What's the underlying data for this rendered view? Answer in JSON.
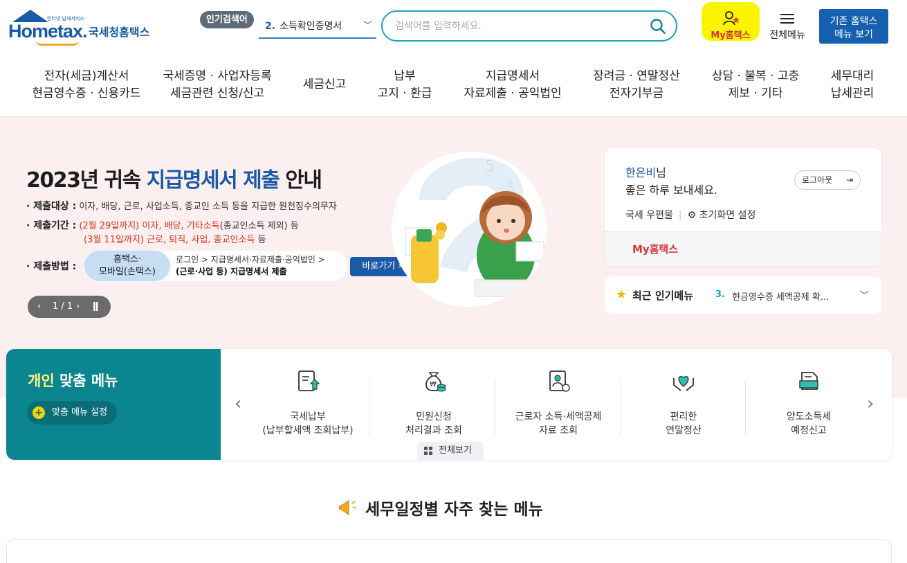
{
  "header": {
    "logo_en": "Hometax.",
    "logo_small": "인터넷 납세서비스",
    "logo_ko": "국세청홈택스",
    "popular_badge": "인기검색어",
    "popular_rank_num": "2.",
    "popular_rank_text": "소득확인증명서",
    "search_placeholder": "검색어를 입력하세요.",
    "my_hometax": "My홈택스",
    "all_menu": "전체메뉴",
    "old_hometax_line1": "기존 홈택스",
    "old_hometax_line2": "메뉴 보기"
  },
  "gnb": [
    {
      "line1": "전자(세금)계산서",
      "line2": "현금영수증 · 신용카드"
    },
    {
      "line1": "국세증명 · 사업자등록",
      "line2": "세금관련 신청/신고"
    },
    {
      "line1": "세금신고",
      "line2": ""
    },
    {
      "line1": "납부",
      "line2": "고지 · 환급"
    },
    {
      "line1": "지급명세서",
      "line2": "자료제출 · 공익법인"
    },
    {
      "line1": "장려금 · 연말정산",
      "line2": "전자기부금"
    },
    {
      "line1": "상담 · 불복 · 고충",
      "line2": "제보 · 기타"
    },
    {
      "line1": "세무대리",
      "line2": "납세관리"
    }
  ],
  "hero": {
    "title_pre": "2023년 귀속 ",
    "title_hl": "지급명세서 제출",
    "title_post": " 안내",
    "target_label": "· 제출대상 :",
    "target_text": "이자, 배당, 근로, 사업소득, 종교인 소득 등을 지급한 원천징수의무자",
    "period_label": "· 제출기간 :",
    "period1_date": "(2월 29일까지)",
    "period1_items": "이자, 배당, 기타소득",
    "period1_note": "(종교인소득 제외) 등",
    "period2_date": "(3월 11일까지)",
    "period2_items": "근로, 퇴직, 사업, 종교인소득",
    "period2_note": "등",
    "method_label": "· 제출방법 :",
    "method_blue_1": "홈택스·",
    "method_blue_2": "모바일(손택스)",
    "method_text_1": "로그인 > 지급명세서·자료제출·공익법인 >",
    "method_text_2": "(근로·사업 등) 지급명세서 제출",
    "go_button": "바로가기",
    "pager_text": "1 / 1"
  },
  "user_card": {
    "name": "한은비",
    "name_suffix": "님",
    "greeting": "좋은 하루 보내세요.",
    "logout": "로그아웃",
    "mailbox": "국세 우편물",
    "home_setting": "초기화면 설정",
    "my_hometax": "My홈택스"
  },
  "popular_menu": {
    "title": "최근 인기메뉴",
    "rank_num": "3.",
    "rank_text": "현금영수증 세액공제 확..."
  },
  "personal_menu": {
    "title_hl": "개인",
    "title_rest": " 맞춤 메뉴",
    "setting": "맞춤 메뉴 설정",
    "items": [
      {
        "line1": "국세납부",
        "line2": "(납부할세액 조회납부)",
        "icon": "tax-payment-icon"
      },
      {
        "line1": "민원신청",
        "line2": "처리결과 조회",
        "icon": "money-bag-icon"
      },
      {
        "line1": "근로자 소득·세액공제",
        "line2": "자료 조회",
        "icon": "deduction-document-icon"
      },
      {
        "line1": "편리한",
        "line2": "연말정산",
        "icon": "heart-hands-icon"
      },
      {
        "line1": "양도소득세",
        "line2": "예정신고",
        "icon": "transfer-tax-icon"
      }
    ],
    "view_all": "전체보기"
  },
  "schedule": {
    "title": "세무일정별 자주 찾는 메뉴"
  }
}
